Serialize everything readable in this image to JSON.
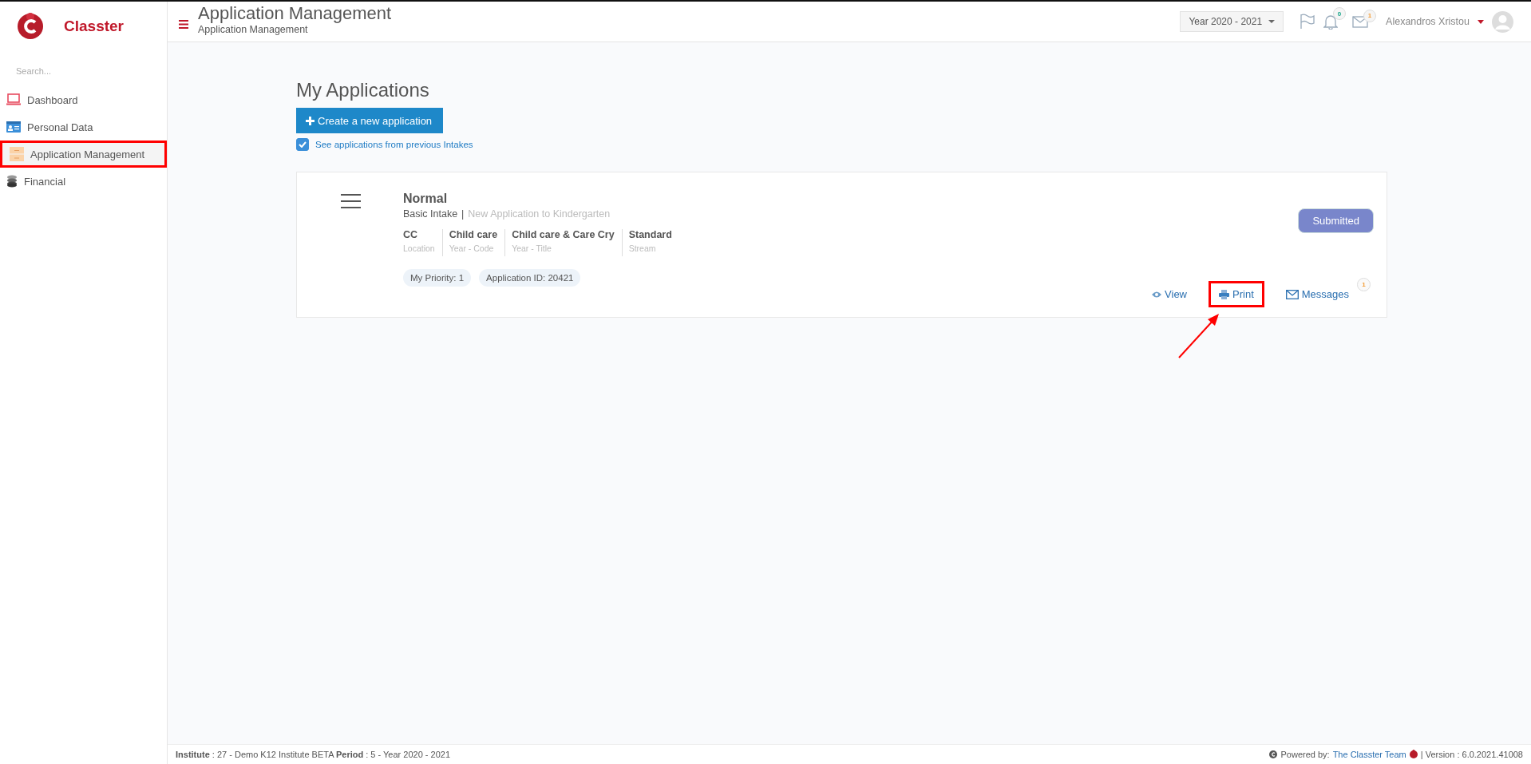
{
  "brand": {
    "name": "Classter"
  },
  "sidebar": {
    "search": {
      "placeholder": "Search..."
    },
    "items": [
      {
        "label": "Dashboard",
        "kind": "laptop",
        "selected": false,
        "highlighted": false
      },
      {
        "label": "Personal Data",
        "kind": "card",
        "selected": false,
        "highlighted": false
      },
      {
        "label": "Application Management",
        "kind": "drawer",
        "selected": true,
        "highlighted": true
      },
      {
        "label": "Financial",
        "kind": "coins",
        "selected": false,
        "highlighted": false
      }
    ]
  },
  "header": {
    "title": "Application Management",
    "subtitle": "Application Management",
    "year_select": "Year 2020 - 2021",
    "notifications_count": "0",
    "messages_count": "1",
    "user": "Alexandros Xristou"
  },
  "page": {
    "heading": "My Applications",
    "create_button": "Create a new application",
    "previous_intakes": {
      "label": "See applications from previous Intakes",
      "checked": true
    }
  },
  "applications": [
    {
      "title": "Normal",
      "intake": "Basic Intake",
      "separator": "|",
      "description": "New Application to Kindergarten",
      "fields": [
        {
          "value": "CC",
          "label": "Location"
        },
        {
          "value": "Child care",
          "label": "Year - Code"
        },
        {
          "value": "Child care & Care Cry",
          "label": "Year - Title"
        },
        {
          "value": "Standard",
          "label": "Stream"
        }
      ],
      "tags": [
        "My Priority: 1",
        "Application ID: 20421"
      ],
      "status": "Submitted",
      "annotation_arrow": true,
      "actions": [
        {
          "label": "View",
          "kind": "view",
          "highlighted": false
        },
        {
          "label": "Print",
          "kind": "print",
          "highlighted": true
        },
        {
          "label": "Messages",
          "kind": "messages",
          "highlighted": false,
          "badge": "1"
        }
      ]
    }
  ],
  "footer": {
    "left": "**Institute** : 27 - Demo K12 Institute BETA **Period** : 5 - Year 2020 - 2021",
    "powered_by": "Powered by:",
    "team_link": "The Classter Team",
    "version": "| Version : 6.0.2021.41008"
  }
}
